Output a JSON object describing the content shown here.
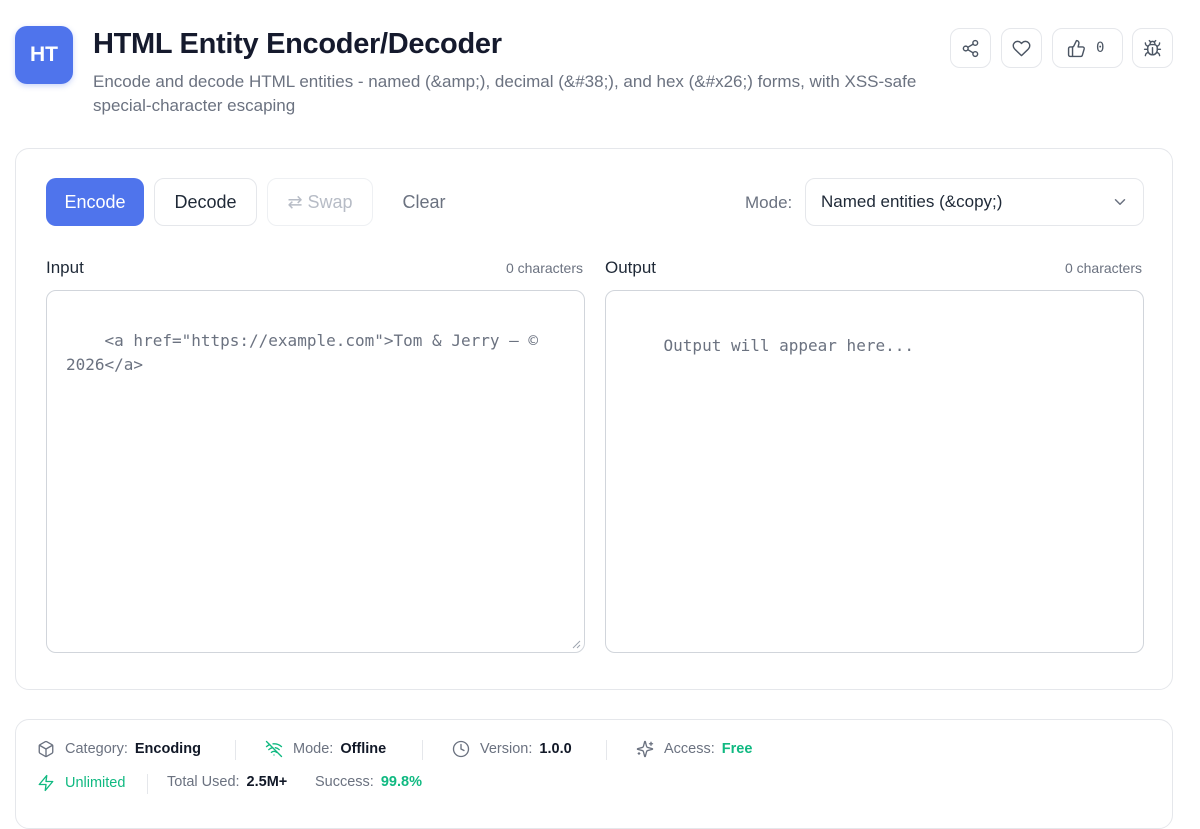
{
  "header": {
    "logo_text": "HT",
    "title": "HTML Entity Encoder/Decoder",
    "subtitle": "Encode and decode HTML entities - named (&amp;), decimal (&#38;), and hex (&#x26;) forms, with XSS-safe special-character escaping",
    "like_count": "0",
    "icons": [
      "share-icon",
      "heart-icon",
      "thumbs-up-icon",
      "bug-icon"
    ]
  },
  "toolbar": {
    "encode_label": "Encode",
    "decode_label": "Decode",
    "swap_label": "⇄ Swap",
    "clear_label": "Clear",
    "mode_label": "Mode:",
    "mode_value": "Named entities (&copy;)"
  },
  "input": {
    "label": "Input",
    "count": "0 characters",
    "placeholder": "<a href=\"https://example.com\">Tom & Jerry — © 2026</a>"
  },
  "output": {
    "label": "Output",
    "count": "0 characters",
    "placeholder": "Output will appear here..."
  },
  "stats": {
    "category_label": "Category:",
    "category_value": "Encoding",
    "mode_label": "Mode:",
    "mode_value": "Offline",
    "version_label": "Version:",
    "version_value": "1.0.0",
    "access_label": "Access:",
    "access_value": "Free",
    "unlimited_label": "Unlimited",
    "total_label": "Total Used:",
    "total_value": "2.5M+",
    "success_label": "Success:",
    "success_value": "99.8%"
  },
  "colors": {
    "primary": "#4f74ec",
    "success": "#10b981",
    "border": "#e5e7eb",
    "muted": "#6b7280"
  }
}
